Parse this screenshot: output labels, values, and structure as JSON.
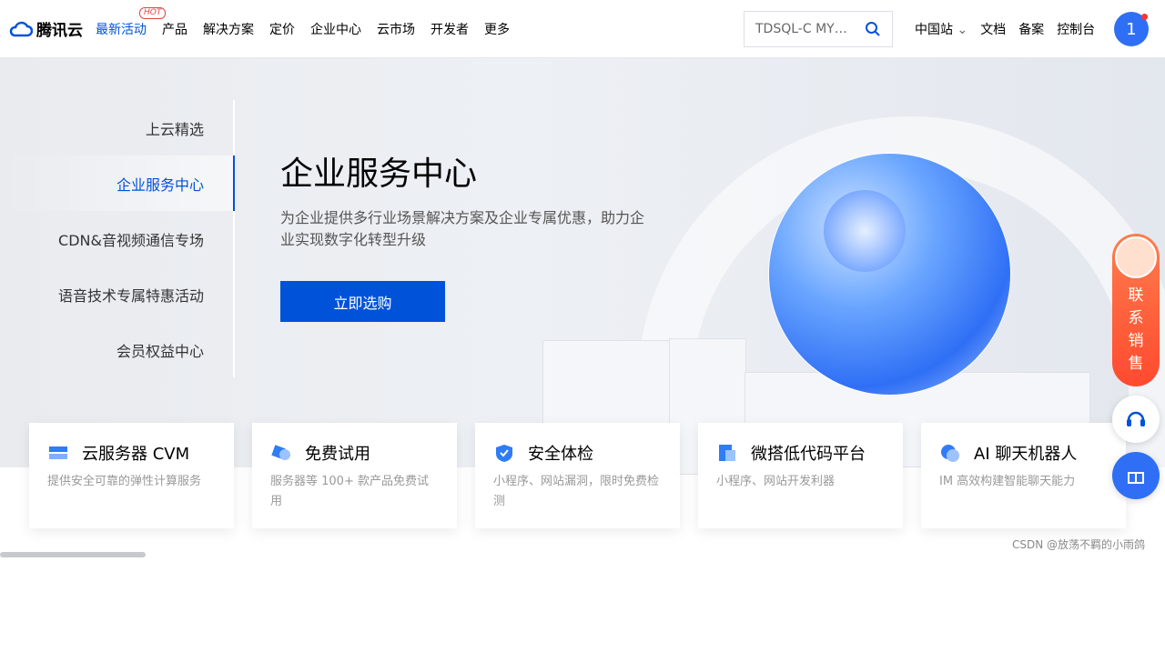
{
  "brand": {
    "name": "腾讯云",
    "accent": "#0052d9"
  },
  "nav": {
    "items": [
      "最新活动",
      "产品",
      "解决方案",
      "定价",
      "企业中心",
      "云市场",
      "开发者",
      "更多"
    ],
    "hot": "HOT",
    "search_placeholder": "TDSQL-C MY…",
    "right": [
      "中国站",
      "文档",
      "备案",
      "控制台"
    ],
    "avatar": "1"
  },
  "hero": {
    "side": [
      "上云精选",
      "企业服务中心",
      "CDN&音视频通信专场",
      "语音技术专属特惠活动",
      "会员权益中心"
    ],
    "title": "企业服务中心",
    "desc": "为企业提供多行业场景解决方案及企业专属优惠，助力企业实现数字化转型升级",
    "button": "立即选购"
  },
  "cards": [
    {
      "title": "云服务器 CVM",
      "desc": "提供安全可靠的弹性计算服务"
    },
    {
      "title": "免费试用",
      "desc": "服务器等 100+ 款产品免费试用"
    },
    {
      "title": "安全体检",
      "desc": "小程序、网站漏洞，限时免费检测"
    },
    {
      "title": "微搭低代码平台",
      "desc": "小程序、网站开发利器"
    },
    {
      "title": "AI 聊天机器人",
      "desc": "IM 高效构建智能聊天能力"
    }
  ],
  "float": {
    "contact": "联系销售"
  },
  "watermark": "CSDN @放荡不羁的小雨鸽"
}
